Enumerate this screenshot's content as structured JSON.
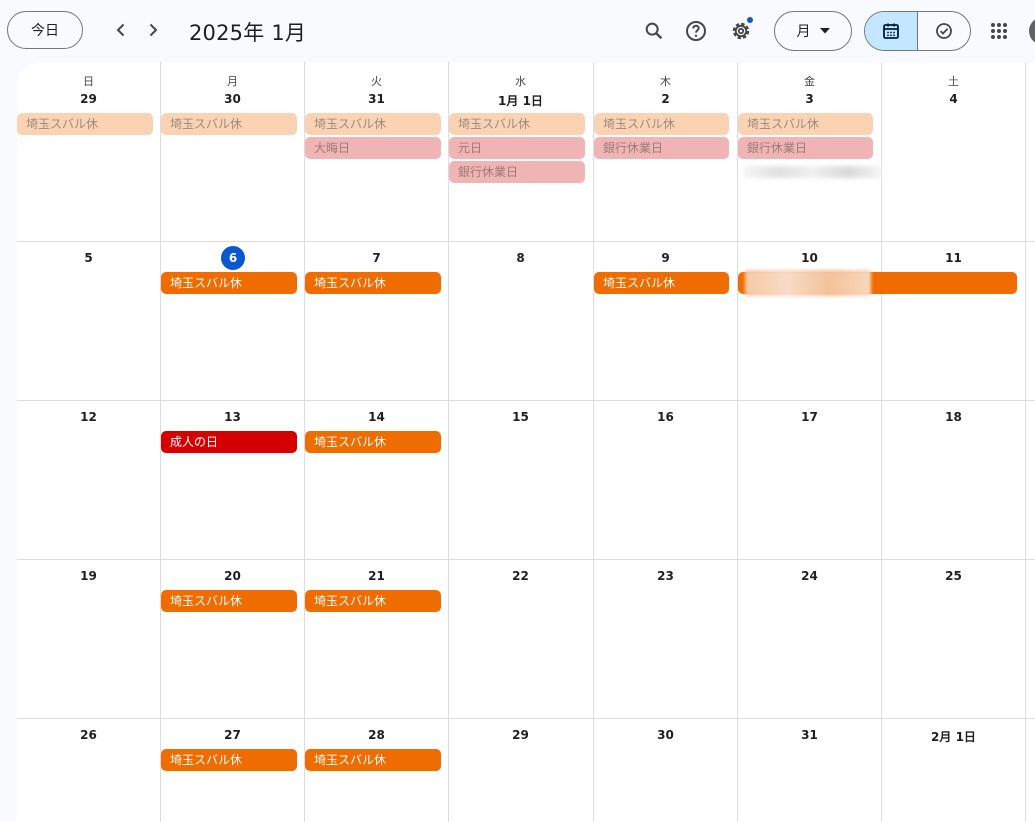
{
  "header": {
    "today_label": "今日",
    "title": "2025年 1月",
    "view_label": "月",
    "icons": {
      "prev": "chevron-left-icon",
      "next": "chevron-right-icon",
      "search": "search-icon",
      "help": "help-icon",
      "settings": "gear-icon",
      "dropdown": "caret-down-icon",
      "calendar_view": "calendar-icon",
      "tasks_view": "check-circle-icon",
      "apps": "apps-grid-icon"
    },
    "colors": {
      "accent": "#0b57d0",
      "selected_segment": "#c2e7ff"
    }
  },
  "calendar": {
    "weekdays": [
      "日",
      "月",
      "火",
      "水",
      "木",
      "金",
      "土"
    ],
    "weeks": [
      [
        "29",
        "30",
        "31",
        "1月 1日",
        "2",
        "3",
        "4"
      ],
      [
        "5",
        "6",
        "7",
        "8",
        "9",
        "10",
        "11"
      ],
      [
        "12",
        "13",
        "14",
        "15",
        "16",
        "17",
        "18"
      ],
      [
        "19",
        "20",
        "21",
        "22",
        "23",
        "24",
        "25"
      ],
      [
        "26",
        "27",
        "28",
        "29",
        "30",
        "31",
        "2月 1日"
      ]
    ],
    "today": "6",
    "events": {
      "saitama_subaru": "埼玉スバル休",
      "omisoka": "大晦日",
      "ganjitsu": "元日",
      "bank_holiday": "銀行休業日",
      "seijin_no_hi": "成人の日"
    },
    "colors": {
      "past_event": "#fcd3b2",
      "past_holiday": "#f1b4b4",
      "event": "#ef6c00",
      "holiday": "#d50000"
    }
  }
}
